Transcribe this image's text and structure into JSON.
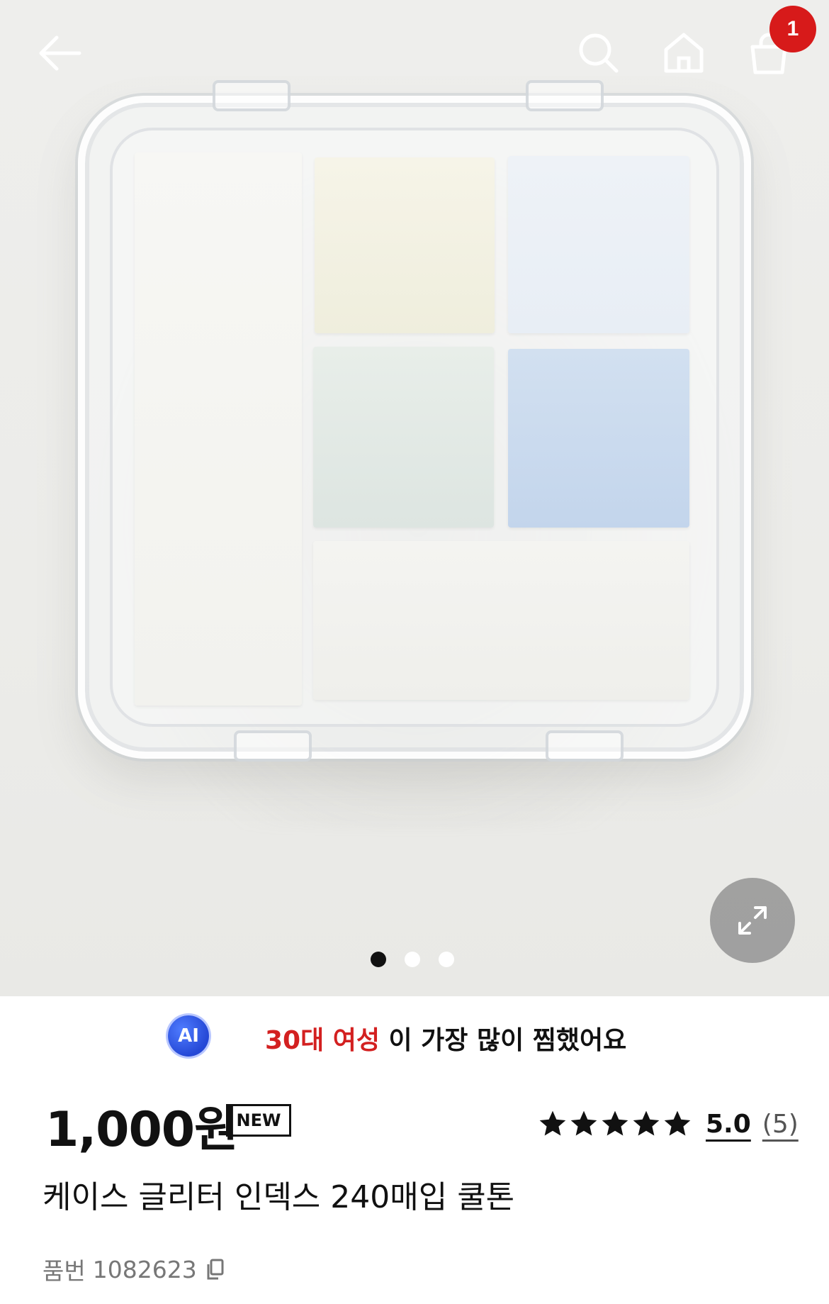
{
  "nav": {
    "back_icon": "arrow-left-icon",
    "search_icon": "search-icon",
    "home_icon": "home-icon",
    "cart_icon": "shopping-bag-icon",
    "cart_count": "1"
  },
  "gallery": {
    "expand_icon": "expand-icon",
    "total_slides": 3,
    "active_slide": 1
  },
  "ai_recommendation": {
    "badge": "AI",
    "highlight": "30대 여성",
    "text": " 이 가장 많이 찜했어요"
  },
  "product": {
    "price": "1,000원",
    "badge": "NEW",
    "rating": {
      "stars": 5,
      "value": "5.0",
      "count": "(5)"
    },
    "title": "케이스 글리터 인덱스 240매입 쿨톤",
    "sku_label": "품번",
    "sku": "1082623",
    "copy_icon": "copy-icon"
  },
  "colors": {
    "accent_red": "#d71a1a",
    "ai_blue": "#2548d6"
  }
}
